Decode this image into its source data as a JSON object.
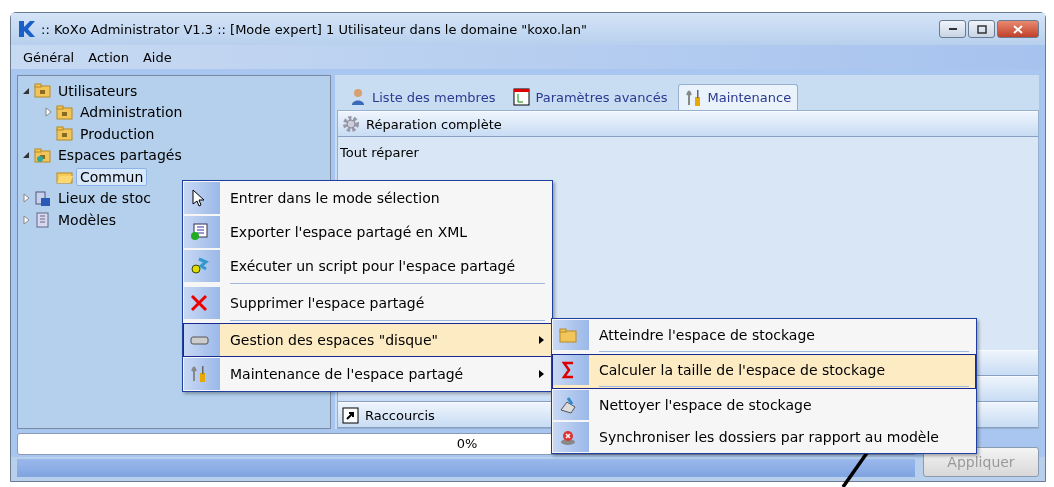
{
  "window": {
    "title": ":: KoXo Administrator V1.3 :: [Mode expert] 1 Utilisateur dans le domaine \"koxo.lan\""
  },
  "menu_bar": [
    {
      "label": "Général"
    },
    {
      "label": "Action"
    },
    {
      "label": "Aide"
    }
  ],
  "tree": [
    {
      "label": "Utilisateurs",
      "expanded": true,
      "selected": false,
      "children": [
        {
          "label": "Administration",
          "expanded": false,
          "selected": false
        },
        {
          "label": "Production",
          "selected": false
        }
      ]
    },
    {
      "label": "Espaces partagés",
      "expanded": true,
      "selected": false,
      "children": [
        {
          "label": "Commun",
          "selected": true
        }
      ]
    },
    {
      "label": "Lieux de stoc",
      "expanded": false,
      "selected": false
    },
    {
      "label": "Modèles",
      "expanded": false,
      "selected": false
    }
  ],
  "tabs": [
    {
      "label": "Liste des membres",
      "selected": false
    },
    {
      "label": "Paramètres avancés",
      "selected": false
    },
    {
      "label": "Maintenance",
      "selected": true
    }
  ],
  "sections_top": [
    {
      "title": "Réparation complète",
      "content": "Tout réparer"
    }
  ],
  "sections_bottom": [
    {
      "kind": "covered"
    },
    {
      "kind": "covered"
    },
    {
      "kind": "shortcut",
      "title": "Raccourcis"
    }
  ],
  "progress": {
    "label": "0%",
    "level": 0
  },
  "apply_button": {
    "label": "Appliquer",
    "disabled": true
  },
  "context_menu": [
    {
      "label": "Entrer dans le mode sélection",
      "selected": false,
      "submenu": false,
      "separator_after": false
    },
    {
      "label": "Exporter l'espace partagé en XML",
      "selected": false,
      "submenu": false,
      "separator_after": false
    },
    {
      "label": "Exécuter un script pour l'espace partagé",
      "selected": false,
      "submenu": false,
      "separator_after": true
    },
    {
      "label": "Supprimer l'espace partagé",
      "selected": false,
      "submenu": false,
      "separator_after": true
    },
    {
      "label": "Gestion des espaces \"disque\"",
      "selected": true,
      "submenu": true,
      "separator_after": false
    },
    {
      "label": "Maintenance de l'espace partagé",
      "selected": false,
      "submenu": true,
      "separator_after": false
    }
  ],
  "submenu": [
    {
      "label": "Atteindre l'espace de stockage",
      "selected": false,
      "separator_after": true
    },
    {
      "label": "Calculer la taille de l'espace de stockage",
      "selected": true,
      "separator_after": true
    },
    {
      "label": "Nettoyer l'espace de stockage",
      "selected": false,
      "separator_after": false
    },
    {
      "label": "Synchroniser les dossiers par rapport au modèle",
      "selected": false,
      "separator_after": false
    }
  ]
}
